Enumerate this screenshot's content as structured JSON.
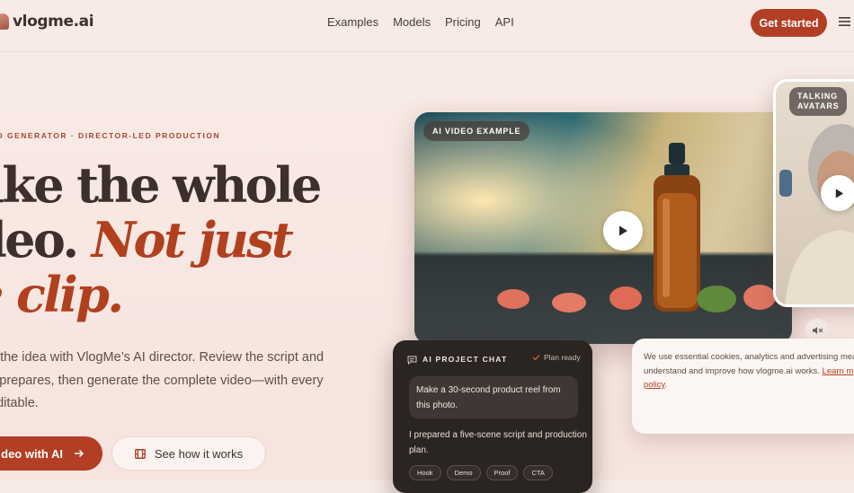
{
  "header": {
    "logo_text": "vlogme.ai",
    "nav": [
      "Examples",
      "Models",
      "Pricing",
      "API"
    ],
    "cta": "Get started"
  },
  "hero": {
    "eyebrow": "O GENERATOR · DIRECTOR-LED PRODUCTION",
    "headline_line1": "ake the whole",
    "headline_line2_plain": "deo. ",
    "headline_line2_accent": "Not just",
    "headline_line3_accent": "e clip.",
    "lede_line1": "h the idea with VlogMe’s AI director. Review the script and",
    "lede_line2": " it prepares, then generate the complete video—with every",
    "lede_line3": "editable.",
    "primary_button": "deo with AI",
    "secondary_button": "See how it works"
  },
  "video": {
    "tag": "AI VIDEO EXAMPLE"
  },
  "avatar": {
    "tag_line1": "TALKING",
    "tag_line2": "AVATARS"
  },
  "chat": {
    "title": "AI PROJECT CHAT",
    "status": "Plan ready",
    "user_message": "Make a 30-second product reel from this photo.",
    "reply": "I prepared a five-scene script and production plan.",
    "chips": [
      "Hook",
      "Demo",
      "Proof",
      "CTA"
    ]
  },
  "cookie": {
    "line1": "We use essential cookies, analytics and advertising mea",
    "line2": "understand and improve how vlogme.ai works. ",
    "link_part1": "Learn m",
    "link_part2": "policy",
    "line3_end": "."
  },
  "colors": {
    "accent": "#b23e24",
    "background": "#f8ebe6",
    "chat_bg": "#2b2522"
  },
  "icons": [
    "menu-icon",
    "arrow-right-icon",
    "film-icon",
    "play-icon",
    "mute-icon",
    "chat-icon",
    "check-icon"
  ]
}
